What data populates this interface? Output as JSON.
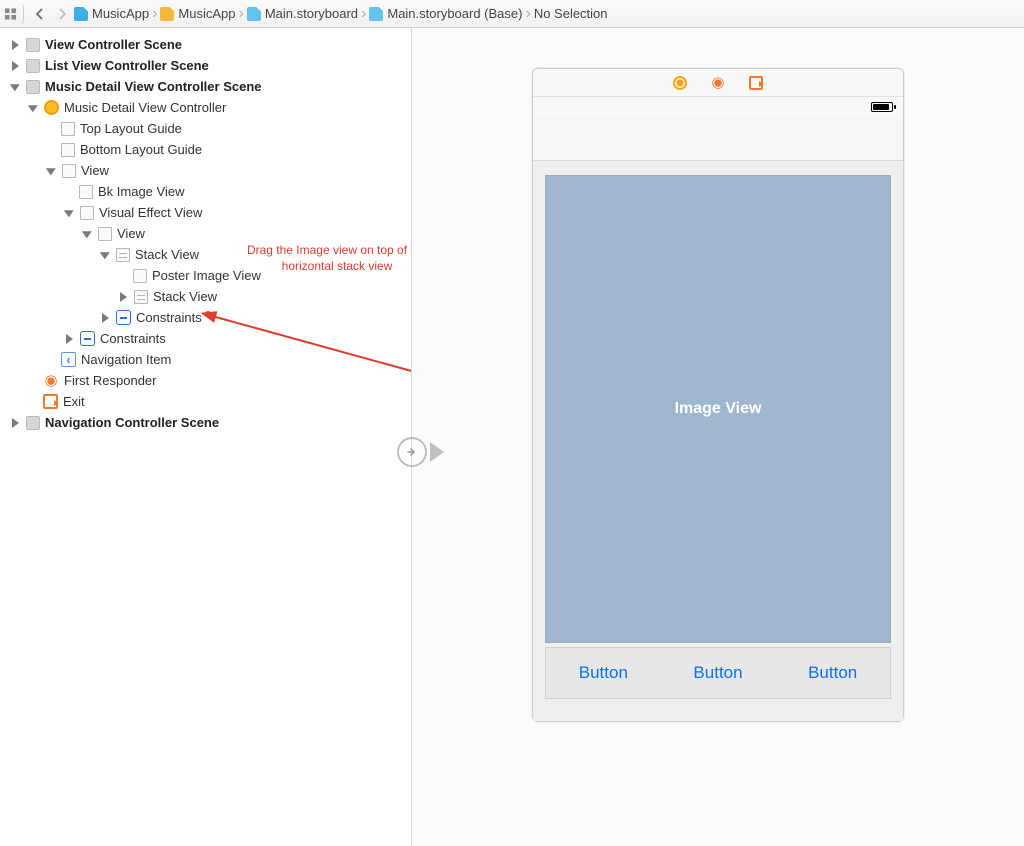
{
  "breadcrumbs": {
    "items": [
      {
        "label": "MusicApp",
        "icon": "fi-blue"
      },
      {
        "label": "MusicApp",
        "icon": "fi-yellow"
      },
      {
        "label": "Main.storyboard",
        "icon": "fi-blue2"
      },
      {
        "label": "Main.storyboard (Base)",
        "icon": "fi-blue2"
      },
      {
        "label": "No Selection",
        "icon": ""
      }
    ]
  },
  "outline": {
    "scene0": "View Controller Scene",
    "scene1": "List View Controller Scene",
    "scene2": "Music Detail View Controller Scene",
    "vc": "Music Detail View Controller",
    "top_guide": "Top Layout Guide",
    "bottom_guide": "Bottom Layout Guide",
    "view": "View",
    "bk_image": "Bk Image View",
    "effect": "Visual Effect View",
    "inner_view": "View",
    "stack": "Stack View",
    "poster": "Poster Image View",
    "stack2": "Stack View",
    "constraints1": "Constraints",
    "constraints2": "Constraints",
    "navitem": "Navigation Item",
    "first_responder": "First Responder",
    "exit": "Exit",
    "scene3": "Navigation Controller Scene"
  },
  "annotation": "Drag the Image view on top of the\nhorizontal stack view",
  "device": {
    "image_view_label": "Image View",
    "button1": "Button",
    "button2": "Button",
    "button3": "Button"
  },
  "colors": {
    "annotation": "#e13a2e",
    "imageview_bg": "#9fb7cc",
    "ios_blue": "#0b6ff9"
  }
}
